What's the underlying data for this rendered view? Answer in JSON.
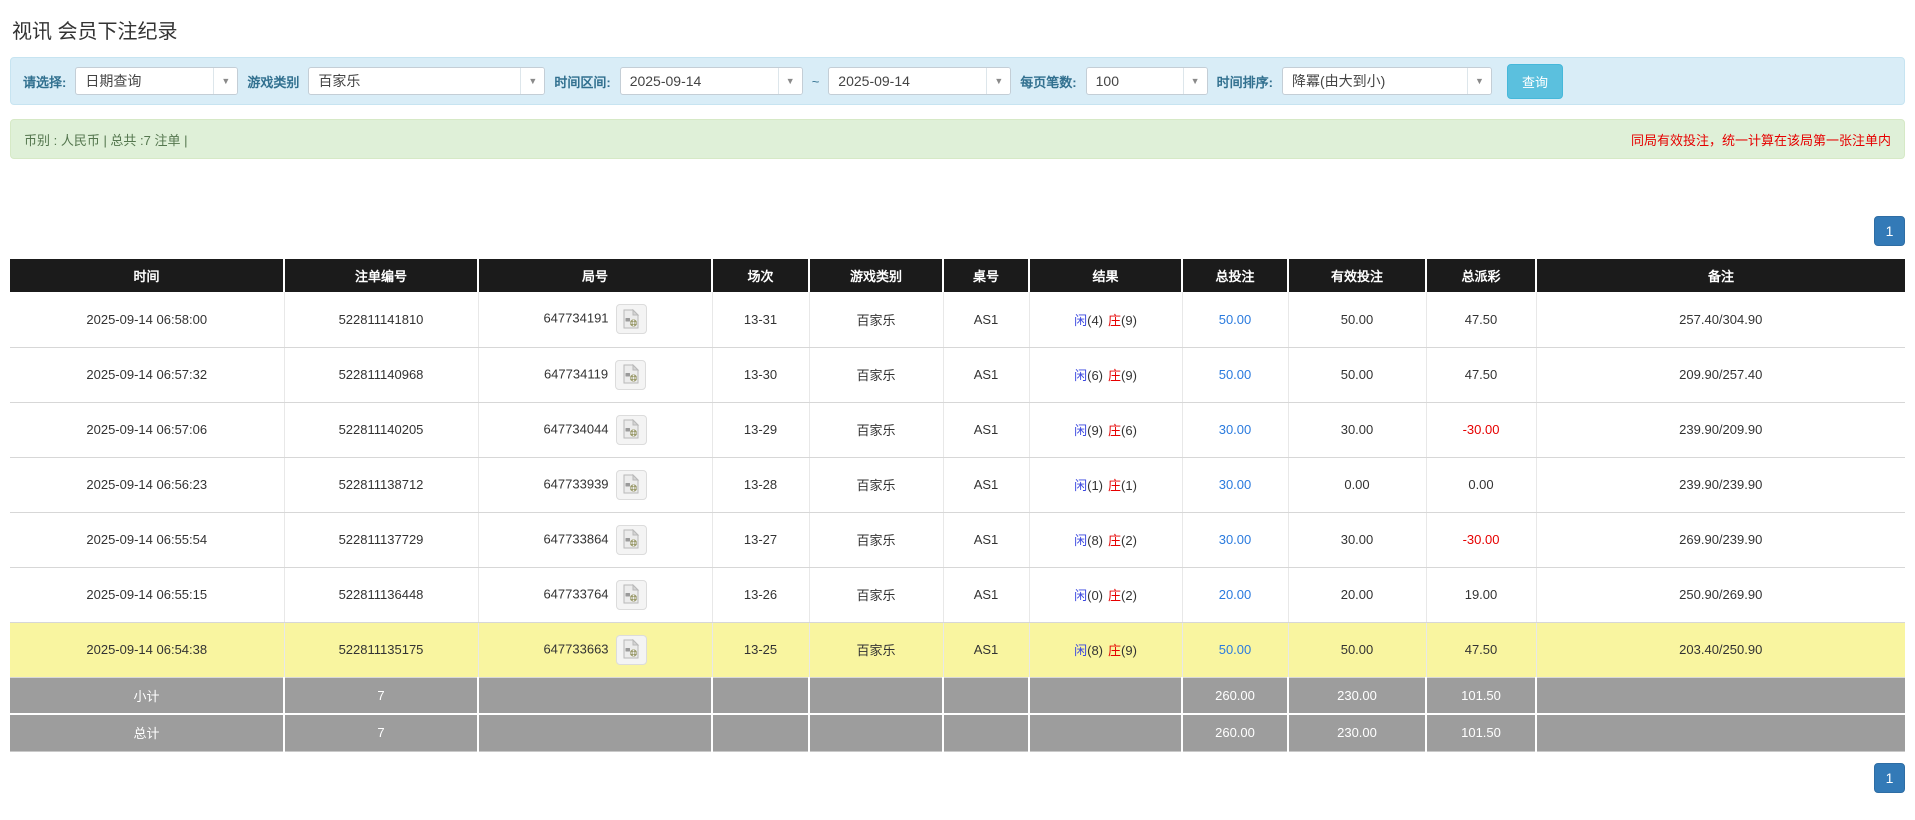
{
  "page": {
    "title": "视讯 会员下注纪录"
  },
  "colors": {
    "header_bg": "#1b1b1b",
    "summary_bg": "#9d9d9d",
    "highlight": "#f9f5a0",
    "link": "#2b7bde",
    "player": "#3b48e0",
    "banker": "#e60000",
    "negative": "#e60000",
    "button": "#5bc0de",
    "pagination": "#337ab7",
    "panel_filter": "#d9edf7",
    "panel_info": "#dff0d8"
  },
  "filters": {
    "select_label": "请选择:",
    "select_value": "日期查询",
    "game_type_label": "游戏类别",
    "game_type_value": "百家乐",
    "date_range_label": "时间区间:",
    "date_from": "2025-09-14",
    "date_separator": "~",
    "date_to": "2025-09-14",
    "page_size_label": "每页笔数:",
    "page_size_value": "100",
    "sort_label": "时间排序:",
    "sort_value": "降冪(由大到小)",
    "query_button": "查询"
  },
  "summary_bar": {
    "left_text": "币别 : 人民币 | 总共 :7 注单 |",
    "right_notice": "同局有效投注，统一计算在该局第一张注单内"
  },
  "pagination": {
    "page": "1"
  },
  "table": {
    "headers": [
      "时间",
      "注单编号",
      "局号",
      "场次",
      "游戏类别",
      "桌号",
      "结果",
      "总投注",
      "有效投注",
      "总派彩",
      "备注"
    ],
    "rows": [
      {
        "time": "2025-09-14 06:58:00",
        "bet_id": "522811141810",
        "round_id": "647734191",
        "session": "13-31",
        "game": "百家乐",
        "table_no": "AS1",
        "result_p": "闲",
        "result_p_n": "(4)",
        "result_b": "庄",
        "result_b_n": "(9)",
        "total_bet": "50.00",
        "valid_bet": "50.00",
        "payout": "47.50",
        "remark": "257.40/304.90",
        "highlight": false
      },
      {
        "time": "2025-09-14 06:57:32",
        "bet_id": "522811140968",
        "round_id": "647734119",
        "session": "13-30",
        "game": "百家乐",
        "table_no": "AS1",
        "result_p": "闲",
        "result_p_n": "(6)",
        "result_b": "庄",
        "result_b_n": "(9)",
        "total_bet": "50.00",
        "valid_bet": "50.00",
        "payout": "47.50",
        "remark": "209.90/257.40",
        "highlight": false
      },
      {
        "time": "2025-09-14 06:57:06",
        "bet_id": "522811140205",
        "round_id": "647734044",
        "session": "13-29",
        "game": "百家乐",
        "table_no": "AS1",
        "result_p": "闲",
        "result_p_n": "(9)",
        "result_b": "庄",
        "result_b_n": "(6)",
        "total_bet": "30.00",
        "valid_bet": "30.00",
        "payout": "-30.00",
        "remark": "239.90/209.90",
        "highlight": false
      },
      {
        "time": "2025-09-14 06:56:23",
        "bet_id": "522811138712",
        "round_id": "647733939",
        "session": "13-28",
        "game": "百家乐",
        "table_no": "AS1",
        "result_p": "闲",
        "result_p_n": "(1)",
        "result_b": "庄",
        "result_b_n": "(1)",
        "total_bet": "30.00",
        "valid_bet": "0.00",
        "payout": "0.00",
        "remark": "239.90/239.90",
        "highlight": false
      },
      {
        "time": "2025-09-14 06:55:54",
        "bet_id": "522811137729",
        "round_id": "647733864",
        "session": "13-27",
        "game": "百家乐",
        "table_no": "AS1",
        "result_p": "闲",
        "result_p_n": "(8)",
        "result_b": "庄",
        "result_b_n": "(2)",
        "total_bet": "30.00",
        "valid_bet": "30.00",
        "payout": "-30.00",
        "remark": "269.90/239.90",
        "highlight": false
      },
      {
        "time": "2025-09-14 06:55:15",
        "bet_id": "522811136448",
        "round_id": "647733764",
        "session": "13-26",
        "game": "百家乐",
        "table_no": "AS1",
        "result_p": "闲",
        "result_p_n": "(0)",
        "result_b": "庄",
        "result_b_n": "(2)",
        "total_bet": "20.00",
        "valid_bet": "20.00",
        "payout": "19.00",
        "remark": "250.90/269.90",
        "highlight": false
      },
      {
        "time": "2025-09-14 06:54:38",
        "bet_id": "522811135175",
        "round_id": "647733663",
        "session": "13-25",
        "game": "百家乐",
        "table_no": "AS1",
        "result_p": "闲",
        "result_p_n": "(8)",
        "result_b": "庄",
        "result_b_n": "(9)",
        "total_bet": "50.00",
        "valid_bet": "50.00",
        "payout": "47.50",
        "remark": "203.40/250.90",
        "highlight": true
      }
    ],
    "subtotal": {
      "label": "小计",
      "count": "7",
      "total_bet": "260.00",
      "valid_bet": "230.00",
      "payout": "101.50"
    },
    "total": {
      "label": "总计",
      "count": "7",
      "total_bet": "260.00",
      "valid_bet": "230.00",
      "payout": "101.50"
    }
  }
}
